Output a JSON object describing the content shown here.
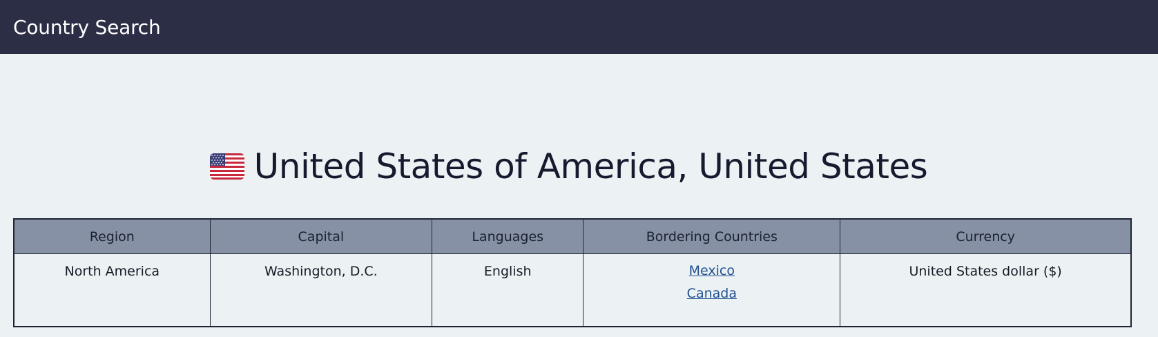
{
  "navbar": {
    "brand": "Country Search"
  },
  "country": {
    "flag_icon": "us-flag-icon",
    "title": "United States of America, United States"
  },
  "table": {
    "headers": [
      "Region",
      "Capital",
      "Languages",
      "Bordering Countries",
      "Currency"
    ],
    "row": {
      "region": "North America",
      "capital": "Washington, D.C.",
      "languages": "English",
      "borders": [
        "Mexico",
        "Canada"
      ],
      "currency": "United States dollar ($)"
    }
  },
  "colors": {
    "navbar_bg": "#2b2e45",
    "page_bg": "#ecf1f4",
    "header_bg": "#8691a6",
    "link": "#1f4f8f"
  }
}
